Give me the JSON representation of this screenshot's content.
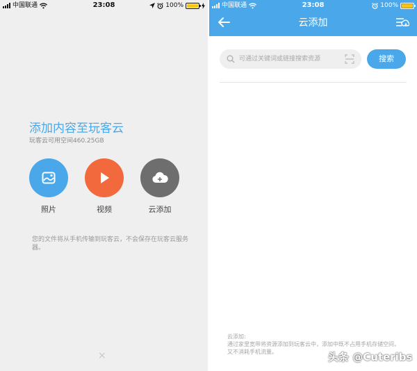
{
  "left_screen": {
    "status_bar": {
      "carrier": "中国联通",
      "time": "23:08",
      "battery": "100%"
    },
    "title": "添加内容至玩客云",
    "subtitle": "玩客云可用空间460.25GB",
    "actions": [
      {
        "label": "照片",
        "color": "#4aa8ea",
        "icon": "photo-icon"
      },
      {
        "label": "视频",
        "color": "#f2693d",
        "icon": "play-icon"
      },
      {
        "label": "云添加",
        "color": "#6e6e6e",
        "icon": "cloud-add-icon"
      }
    ],
    "note": "您的文件将从手机传输到玩客云，不会保存在玩客云服务器。",
    "close_icon": "×"
  },
  "right_screen": {
    "status_bar": {
      "carrier": "中国联通",
      "time": "23:08",
      "battery": "100%"
    },
    "header": {
      "title": "云添加",
      "color": "#4aa8ea"
    },
    "search": {
      "placeholder": "可通过关键词或链接搜索资源",
      "button_label": "搜索"
    },
    "footer_note_title": "云添加:",
    "footer_note": "通过家里宽带将资源添加到玩客云中，添加中既不占用手机存储空间，又不消耗手机流量。"
  },
  "watermark": "头条 @Cuteribs"
}
